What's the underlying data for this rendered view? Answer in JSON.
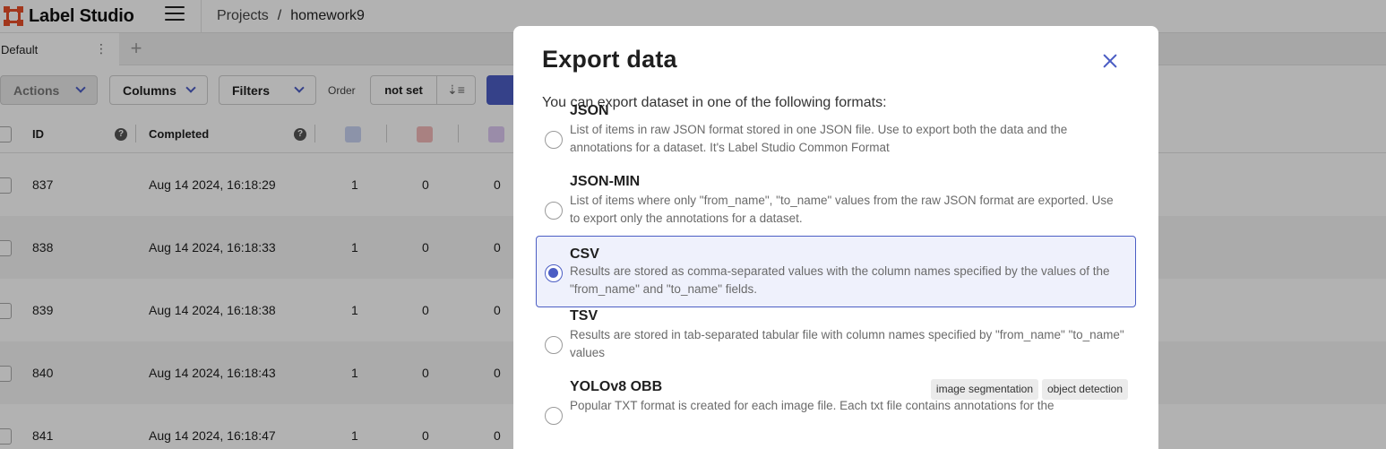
{
  "app": {
    "name": "Label Studio"
  },
  "breadcrumb": {
    "projects": "Projects",
    "separator": "/",
    "current": "homework9"
  },
  "tabs": {
    "default_label": "Default",
    "menu_glyph": "⋮",
    "add_glyph": "+"
  },
  "toolbar": {
    "actions_label": "Actions",
    "columns_label": "Columns",
    "filters_label": "Filters",
    "order_label": "Order",
    "order_value": "not set",
    "sort_glyph": "⇣≡"
  },
  "table": {
    "headers": {
      "id": "ID",
      "completed": "Completed",
      "help_glyph": "?"
    },
    "rows": [
      {
        "id": "837",
        "completed": "Aug 14 2024, 16:18:29",
        "annotations": "1",
        "cancelled": "0",
        "predictions": "0"
      },
      {
        "id": "838",
        "completed": "Aug 14 2024, 16:18:33",
        "annotations": "1",
        "cancelled": "0",
        "predictions": "0"
      },
      {
        "id": "839",
        "completed": "Aug 14 2024, 16:18:38",
        "annotations": "1",
        "cancelled": "0",
        "predictions": "0"
      },
      {
        "id": "840",
        "completed": "Aug 14 2024, 16:18:43",
        "annotations": "1",
        "cancelled": "0",
        "predictions": "0"
      },
      {
        "id": "841",
        "completed": "Aug 14 2024, 16:18:47",
        "annotations": "1",
        "cancelled": "0",
        "predictions": "0"
      }
    ]
  },
  "modal": {
    "title": "Export data",
    "intro": "You can export dataset in one of the following formats:",
    "formats": [
      {
        "title": "JSON",
        "description": "List of items in raw JSON format stored in one JSON file. Use to export both the data and the annotations for a dataset. It's Label Studio Common Format",
        "selected": false
      },
      {
        "title": "JSON-MIN",
        "description": "List of items where only \"from_name\", \"to_name\" values from the raw JSON format are exported. Use to export only the annotations for a dataset.",
        "selected": false
      },
      {
        "title": "CSV",
        "description": "Results are stored as comma-separated values with the column names specified by the values of the \"from_name\" and \"to_name\" fields.",
        "selected": true
      },
      {
        "title": "TSV",
        "description": "Results are stored in tab-separated tabular file with column names specified by \"from_name\" \"to_name\" values",
        "selected": false
      },
      {
        "title": "YOLOv8 OBB",
        "description": "Popular TXT format is created for each image file. Each txt file contains annotations for the",
        "selected": false,
        "tags": [
          "image segmentation",
          "object detection"
        ]
      }
    ]
  },
  "colors": {
    "accent": "#4c5ec4",
    "brand": "#e8502a",
    "selected_bg": "#eff1fc"
  },
  "icons": {
    "column_annotations": "annotations-icon",
    "column_cancelled": "cancelled-icon",
    "column_predictions": "predictions-icon"
  }
}
